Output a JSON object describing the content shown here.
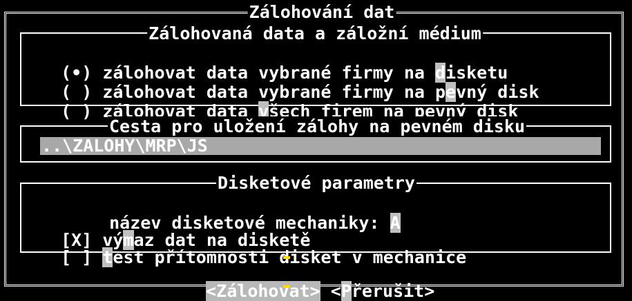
{
  "dialog": {
    "title": "Zálohování dat"
  },
  "group_media": {
    "title": "Zálohovaná data a záložní médium",
    "options": [
      {
        "marker": "(•)",
        "pre": "zálohovat data vybrané firmy na ",
        "hotkey": "d",
        "post": "isketu",
        "selected": true
      },
      {
        "marker": "( )",
        "pre": "zálohovat data vybrané firmy na p",
        "hotkey": "e",
        "post": "vný disk",
        "selected": false
      },
      {
        "marker": "( )",
        "pre": "zálohovat data ",
        "hotkey": "v",
        "post": "šech firem na pevný disk",
        "selected": false
      }
    ]
  },
  "group_path": {
    "title": "Cesta pro uložení zálohy na pevném disku",
    "value": "..\\ZALOHY\\MRP\\JS"
  },
  "group_floppy": {
    "title": "Disketové parametry",
    "drive_label": "název disketové mechaniky:",
    "drive_value": "A",
    "erase": {
      "mark": "[X]",
      "pre": "vý",
      "hotkey": "m",
      "post": "az dat na disketě",
      "checked": true
    },
    "test": {
      "mark": "[ ]",
      "pre": "",
      "hotkey": "t",
      "post": "est přítomnosti disket v mechanice",
      "checked": false
    }
  },
  "buttons": {
    "backup": "<Zálohovat>",
    "cancel_pre": "<",
    "cancel_hotkey": "P",
    "cancel_post": "řerušit>"
  }
}
